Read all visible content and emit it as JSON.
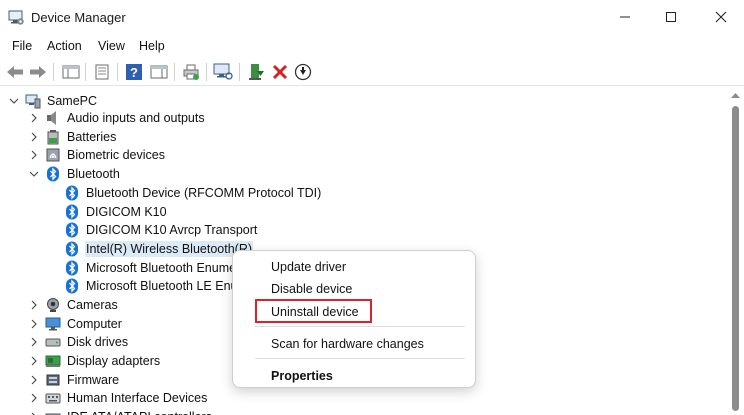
{
  "window": {
    "title": "Device Manager"
  },
  "menu": [
    "File",
    "Action",
    "View",
    "Help"
  ],
  "tree": {
    "root": "SamePC",
    "categories": [
      "Audio inputs and outputs",
      "Batteries",
      "Biometric devices",
      "Bluetooth",
      "Cameras",
      "Computer",
      "Disk drives",
      "Display adapters",
      "Firmware",
      "Human Interface Devices",
      "IDE ATA/ATAPI controllers"
    ],
    "bluetooth_devices": [
      "Bluetooth Device (RFCOMM Protocol TDI)",
      "DIGICOM K10",
      "DIGICOM K10 Avrcp Transport",
      "Intel(R) Wireless Bluetooth(R)",
      "Microsoft Bluetooth Enumerator",
      "Microsoft Bluetooth LE Enumerator"
    ]
  },
  "context_menu": {
    "items": [
      "Update driver",
      "Disable device",
      "Uninstall device",
      "Scan for hardware changes",
      "Properties"
    ],
    "highlighted": "Uninstall device"
  },
  "colors": {
    "highlight_border": "#d9232e",
    "selection": "#dce9f7",
    "bluetooth": "#1672d6"
  }
}
